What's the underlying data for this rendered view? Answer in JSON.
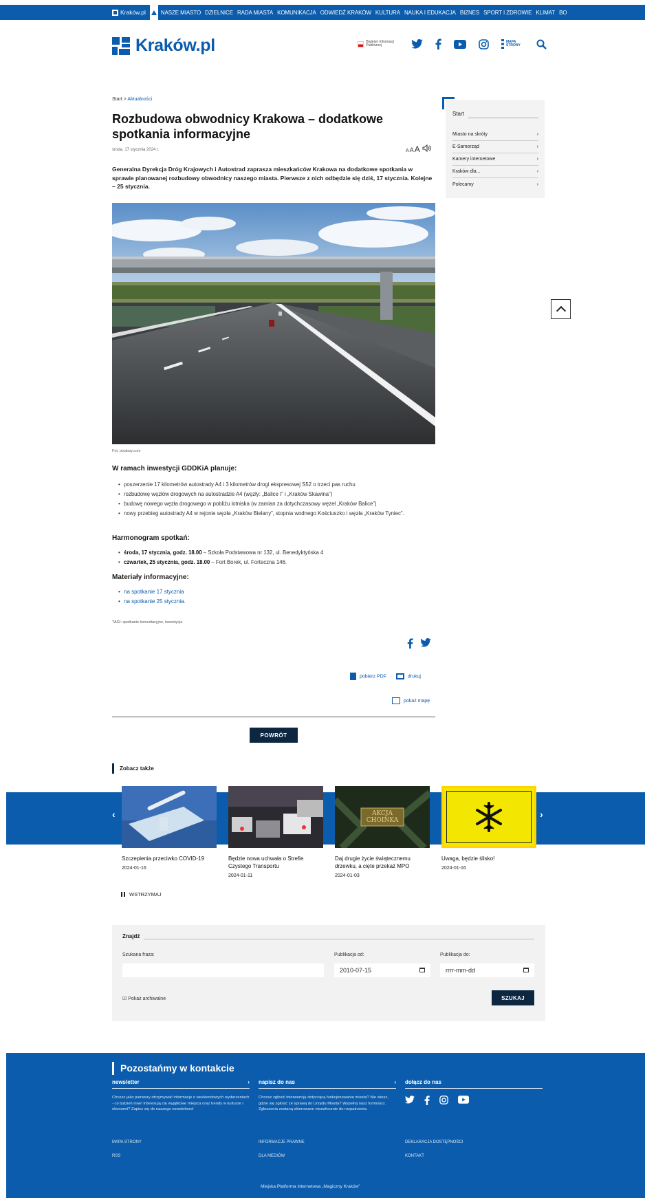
{
  "topbar": {
    "brand": "Kraków.pl",
    "items": [
      "NASZE MIASTO",
      "DZIELNICE",
      "RADA MIASTA",
      "KOMUNIKACJA",
      "ODWIEDŹ KRAKÓW",
      "KULTURA",
      "NAUKA I EDUKACJA",
      "BIZNES",
      "SPORT I ZDROWIE",
      "KLIMAT",
      "BO"
    ]
  },
  "header": {
    "logo": "Kraków.pl",
    "bip_label": "Biuletyn Informacji Publicznej",
    "sitemap_label": "MAPA STRONY",
    "icons": [
      "twitter-icon",
      "facebook-icon",
      "youtube-icon",
      "instagram-icon",
      "sitemap-icon",
      "search-icon"
    ]
  },
  "breadcrumb": {
    "home": "Start",
    "sep": ">",
    "current": "Aktualności"
  },
  "article": {
    "title": "Rozbudowa obwodnicy Krakowa – dodatkowe spotkania informacyjne",
    "date": "środa, 17 stycznia 2024 r.",
    "font_tools": "AAA",
    "lead": "Generalna Dyrekcja Dróg Krajowych i Autostrad zaprasza mieszkańców Krakowa na dodatkowe spotkania w sprawie planowanej rozbudowy obwodnicy naszego miasta. Pierwsze z nich odbędzie się dziś, 17 stycznia. Kolejne – 25 stycznia.",
    "photo_caption": "Fot. pixabay.com",
    "plan_heading": "W ramach inwestycji GDDKiA planuje:",
    "plan_items": [
      "poszerzenie 17 kilometrów autostrady A4 i 3 kilometrów drogi ekspresowej S52 o trzeci pas ruchu",
      "rozbudowę węzłów drogowych na autostradzie A4 (węzły: „Balice I” i „Kraków Skawina”)",
      "budowę nowego węzła drogowego w pobliżu lotniska (w zamian za dotychczasowy węzeł „Kraków Balice”)",
      "nowy przebieg autostrady A4 w rejonie węzła „Kraków Bielany”, stopnia wodnego Kościuszko i węzła „Kraków Tyniec”."
    ],
    "harm_heading": "Harmonogram spotkań:",
    "harm_items": [
      {
        "bold": "środa, 17 stycznia, godz. 18.00",
        "rest": " – Szkoła Podstawowa nr 132, ul. Benedyktyńska 4"
      },
      {
        "bold": "czwartek, 25 stycznia, godz. 18.00",
        "rest": " – Fort Borek, ul. Forteczna 146."
      }
    ],
    "mat_heading": "Materiały informacyjne:",
    "mat_items": [
      "na spotkanie 17 stycznia",
      "na spotkanie 25 stycznia."
    ],
    "tags": "TAGI: spotkanie konsultacyjne, inwestycja",
    "pdf_label": "pobierz PDF",
    "print_label": "drukuj",
    "map_label": "pokaż mapę",
    "back_label": "POWRÓT"
  },
  "sidebar": {
    "title": "Start",
    "items": [
      "Miasto na skróty",
      "E-Samorząd",
      "Kamery internetowe",
      "Kraków dla...",
      "Polecamy"
    ]
  },
  "see_also": {
    "heading": "Zobacz także",
    "cards": [
      {
        "title": "Szczepienia przeciwko COVID-19",
        "date": "2024-01-16"
      },
      {
        "title": "Będzie nowa uchwała o Strefie Czystego Transportu",
        "date": "2024-01-11"
      },
      {
        "title": "Daj drugie życie świątecznemu drzewku, a cięte przekaż MPO",
        "date": "2024-01-03",
        "img_text": "AKCJA CHOINKA"
      },
      {
        "title": "Uwaga, będzie ślisko!",
        "date": "2024-01-16"
      }
    ],
    "pause_label": "WSTRZYMAJ"
  },
  "search": {
    "heading": "Znajdź",
    "phrase_label": "Szukana fraza:",
    "phrase_value": "",
    "from_label": "Publikacja od:",
    "from_value": "2010-07-15",
    "to_label": "Publikacja do:",
    "to_value": "rrrr-mm-dd",
    "archive_label": "Pokaż archiwalne",
    "button": "SZUKAJ"
  },
  "footer": {
    "heading": "Pozostańmy w kontakcie",
    "newsletter": {
      "title": "newsletter",
      "text": "Chcesz jako pierwszy otrzymywać informacje o weekendowych wydarzeniach - co tydzień inne! Interesują cię wyjątkowe miejsca oraz trendy w kulturze i ekonomii? Zapisz się do naszego newslettera!"
    },
    "write": {
      "title": "napisz do nas",
      "text": "Chcesz zgłosić interwencję dotyczącą funkcjonowania miasta? Nie wiesz, gdzie się zgłosić ze sprawą do Urzędu Miasta? Wypełnij nasz formularz. Zgłoszenia zostaną skierowane niezwłocznie do rozpatrzenia."
    },
    "join": {
      "title": "dołącz do nas"
    },
    "links": [
      "MAPA STRONY",
      "RSS",
      "INFORMACJE PRAWNE",
      "DLA MEDIÓW",
      "DEKLARACJA DOSTĘPNOŚCI",
      "KONTAKT"
    ],
    "copy": "Miejska Platforma Internetowa „Magiczny Kraków”"
  }
}
